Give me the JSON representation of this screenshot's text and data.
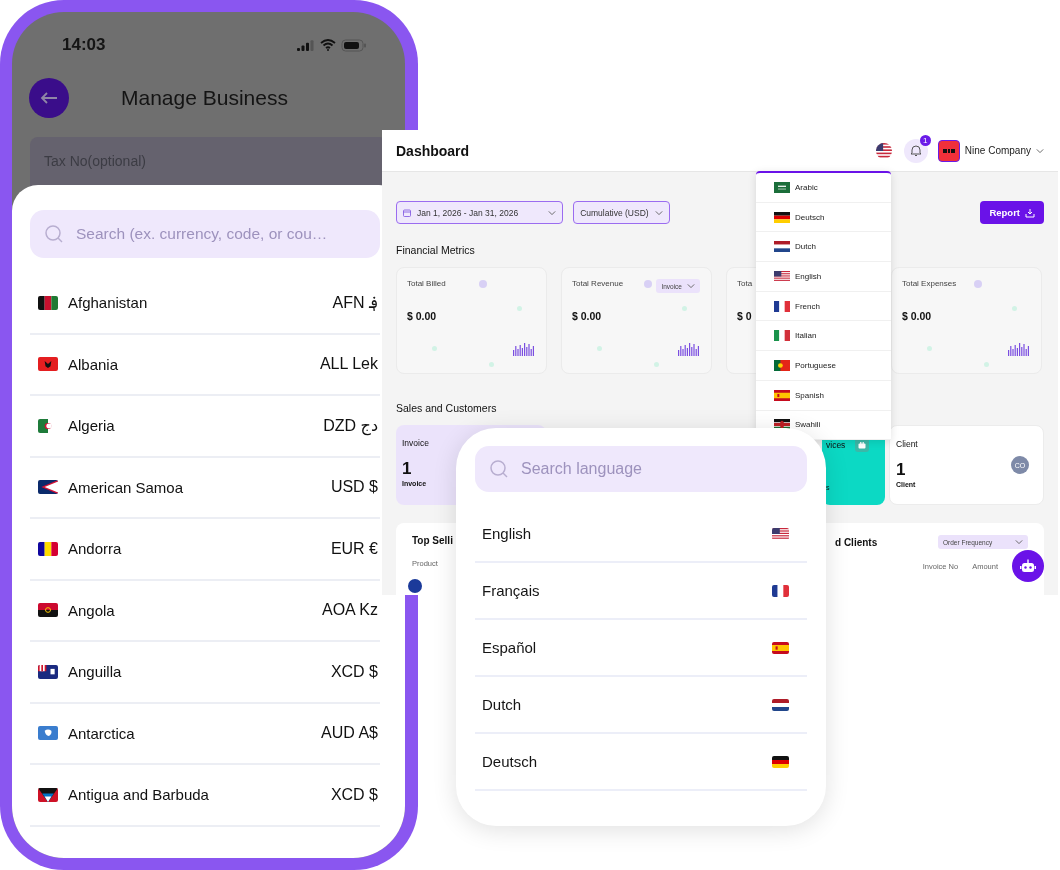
{
  "phone": {
    "status_bar": {
      "time": "14:03"
    },
    "header": {
      "title": "Manage Business"
    },
    "background_field": {
      "placeholder": "Tax No(optional)"
    },
    "sheet": {
      "search": {
        "placeholder": "Search (ex. currency, code, or cou…"
      },
      "countries": [
        {
          "name": "Afghanistan",
          "currency": "AFN ؋",
          "kind": "af"
        },
        {
          "name": "Albania",
          "currency": "ALL Lek",
          "kind": "al"
        },
        {
          "name": "Algeria",
          "currency": "DZD دج",
          "kind": "dz"
        },
        {
          "name": "American Samoa",
          "currency": "USD $",
          "kind": "as"
        },
        {
          "name": "Andorra",
          "currency": "EUR €",
          "kind": "ad"
        },
        {
          "name": "Angola",
          "currency": "AOA Kz",
          "kind": "ao"
        },
        {
          "name": "Anguilla",
          "currency": "XCD $",
          "kind": "ai"
        },
        {
          "name": "Antarctica",
          "currency": "AUD A$",
          "kind": "aq"
        },
        {
          "name": "Antigua and Barbuda",
          "currency": "XCD $",
          "kind": "ag"
        }
      ]
    }
  },
  "dashboard": {
    "title": "Dashboard",
    "notifications": {
      "count": "1"
    },
    "company": {
      "name": "Nine Company"
    },
    "filters": {
      "date_range": "Jan 1, 2026 - Jan 31, 2026",
      "mode": "Cumulative (USD)"
    },
    "report_button": "Report",
    "financial_section": "Financial Metrics",
    "metric_cards": [
      {
        "title": "Total Billed",
        "value": "$ 0.00"
      },
      {
        "title": "Total Revenue",
        "value": "$ 0.00",
        "dropdown": "Invoice"
      },
      {
        "title": "Tota",
        "value": "$ 0"
      },
      {
        "title": "Total Expenses",
        "value": "$ 0.00"
      }
    ],
    "sales_section": "Sales and Customers",
    "sales_cards": [
      {
        "kind": "invoice",
        "title": "Invoice",
        "value": "1",
        "caption": "Invoice"
      },
      {
        "kind": "services",
        "title": "vices",
        "caption": "s"
      },
      {
        "kind": "client",
        "title": "Client",
        "value": "1",
        "caption": "Client",
        "avatar": "CO"
      }
    ],
    "panels": [
      {
        "title": "Top Selli",
        "columns": [
          "Product"
        ]
      },
      {
        "title": "d Clients",
        "dropdown": "Order Frequency",
        "columns": [
          "Invoice No",
          "Amount"
        ]
      }
    ],
    "language_menu": [
      {
        "label": "Arabic",
        "kind": "sa"
      },
      {
        "label": "Deutsch",
        "kind": "de"
      },
      {
        "label": "Dutch",
        "kind": "nl"
      },
      {
        "label": "English",
        "kind": "us"
      },
      {
        "label": "French",
        "kind": "fr"
      },
      {
        "label": "Italian",
        "kind": "it"
      },
      {
        "label": "Portuguese",
        "kind": "pt"
      },
      {
        "label": "Spanish",
        "kind": "es"
      },
      {
        "label": "Swahili",
        "kind": "ke"
      }
    ]
  },
  "language_picker": {
    "search": {
      "placeholder": "Search language"
    },
    "languages": [
      {
        "label": "English",
        "kind": "us"
      },
      {
        "label": "Français",
        "kind": "fr"
      },
      {
        "label": "Español",
        "kind": "es"
      },
      {
        "label": "Dutch",
        "kind": "nl"
      },
      {
        "label": "Deutsch",
        "kind": "de"
      }
    ]
  }
}
